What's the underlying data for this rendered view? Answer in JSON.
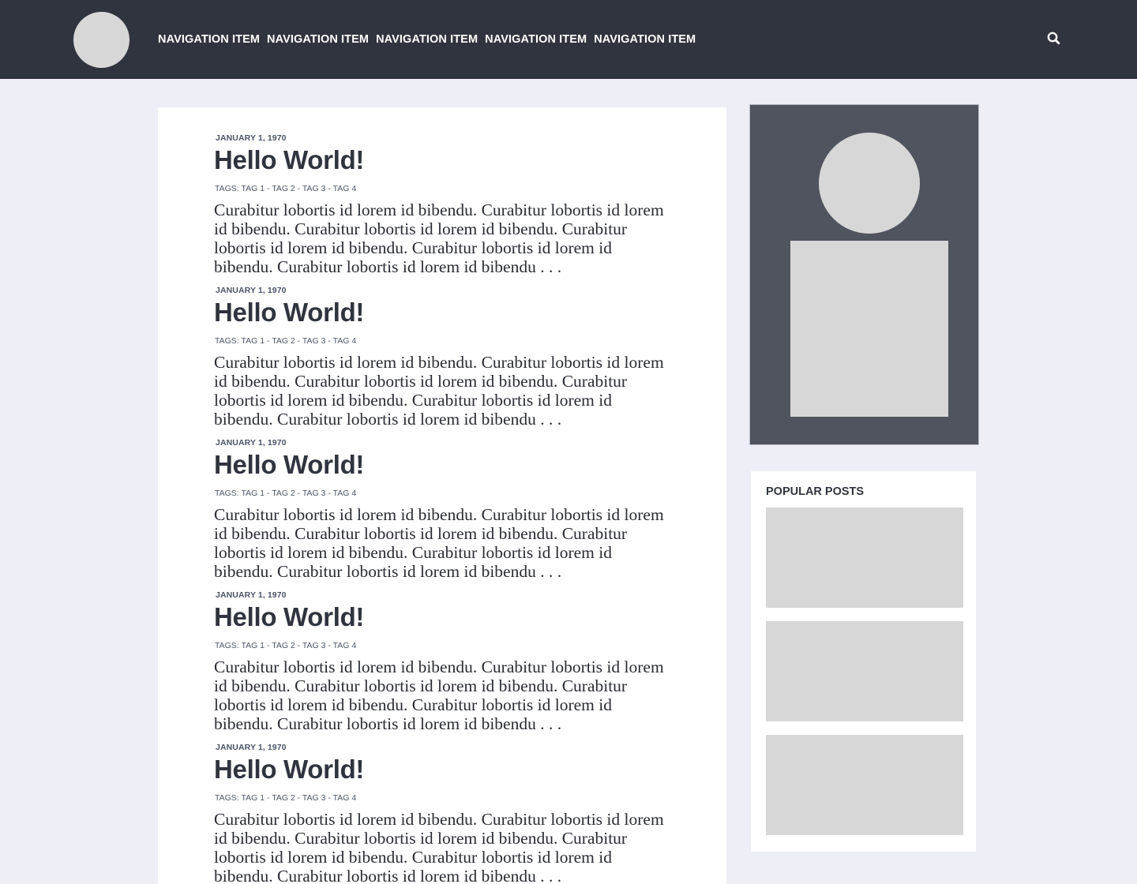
{
  "header": {
    "nav_items": [
      "NAVIGATION ITEM",
      "NAVIGATION ITEM",
      "NAVIGATION ITEM",
      "NAVIGATION ITEM",
      "NAVIGATION ITEM"
    ],
    "search_icon": "search-icon"
  },
  "posts": [
    {
      "date": "JANUARY 1, 1970",
      "title": "Hello World!",
      "tags_prefix": "TAGS:",
      "tags": [
        "TAG 1",
        "TAG 2",
        "TAG 3",
        "TAG 4"
      ],
      "tag_separator": " - ",
      "excerpt": "Curabitur lobortis id lorem id bibendu. Curabitur lobortis id lorem id bibendu. Curabitur lobortis id lorem id bibendu. Curabitur lobortis id lorem id bibendu. Curabitur lobortis id lorem id bibendu. Curabitur lobortis id lorem id bibendu . . ."
    },
    {
      "date": "JANUARY 1, 1970",
      "title": "Hello World!",
      "tags_prefix": "TAGS:",
      "tags": [
        "TAG 1",
        "TAG 2",
        "TAG 3",
        "TAG 4"
      ],
      "tag_separator": " - ",
      "excerpt": "Curabitur lobortis id lorem id bibendu. Curabitur lobortis id lorem id bibendu. Curabitur lobortis id lorem id bibendu. Curabitur lobortis id lorem id bibendu. Curabitur lobortis id lorem id bibendu. Curabitur lobortis id lorem id bibendu . . ."
    },
    {
      "date": "JANUARY 1, 1970",
      "title": "Hello World!",
      "tags_prefix": "TAGS:",
      "tags": [
        "TAG 1",
        "TAG 2",
        "TAG 3",
        "TAG 4"
      ],
      "tag_separator": " - ",
      "excerpt": "Curabitur lobortis id lorem id bibendu. Curabitur lobortis id lorem id bibendu. Curabitur lobortis id lorem id bibendu. Curabitur lobortis id lorem id bibendu. Curabitur lobortis id lorem id bibendu. Curabitur lobortis id lorem id bibendu . . ."
    },
    {
      "date": "JANUARY 1, 1970",
      "title": "Hello World!",
      "tags_prefix": "TAGS:",
      "tags": [
        "TAG 1",
        "TAG 2",
        "TAG 3",
        "TAG 4"
      ],
      "tag_separator": " - ",
      "excerpt": "Curabitur lobortis id lorem id bibendu. Curabitur lobortis id lorem id bibendu. Curabitur lobortis id lorem id bibendu. Curabitur lobortis id lorem id bibendu. Curabitur lobortis id lorem id bibendu. Curabitur lobortis id lorem id bibendu . . ."
    },
    {
      "date": "JANUARY 1, 1970",
      "title": "Hello World!",
      "tags_prefix": "TAGS:",
      "tags": [
        "TAG 1",
        "TAG 2",
        "TAG 3",
        "TAG 4"
      ],
      "tag_separator": " - ",
      "excerpt": "Curabitur lobortis id lorem id bibendu. Curabitur lobortis id lorem id bibendu. Curabitur lobortis id lorem id bibendu. Curabitur lobortis id lorem id bibendu. Curabitur lobortis id lorem id bibendu. Curabitur lobortis id lorem id bibendu . . ."
    }
  ],
  "sidebar": {
    "popular_heading": "POPULAR POSTS"
  },
  "colors": {
    "header_bg": "#30343e",
    "page_bg": "#eeeef7",
    "profile_bg": "#50545e",
    "placeholder": "#d8d7d8",
    "meta_text": "#4b5466"
  }
}
